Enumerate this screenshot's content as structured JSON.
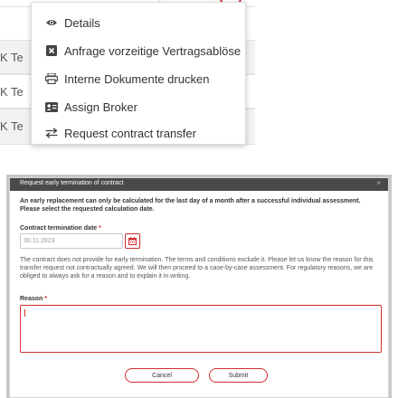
{
  "table": {
    "row_truncated_label": "K Te"
  },
  "context_menu": {
    "items": [
      {
        "label": "Details",
        "icon": "eye-icon"
      },
      {
        "label": "Anfrage vorzeitige Vertragsablöse",
        "icon": "close-box-icon"
      },
      {
        "label": "Interne Dokumente drucken",
        "icon": "print-icon"
      },
      {
        "label": "Assign Broker",
        "icon": "id-card-icon"
      },
      {
        "label": "Request contract transfer",
        "icon": "transfer-arrows-icon"
      }
    ]
  },
  "dialog": {
    "title": "Request early termination of contract",
    "close_glyph": "×",
    "notice_line1": "An early replacement can only be calculated for the last day of a month after a successful individual assessment.",
    "notice_line2": "Please select the requested calculation date.",
    "date_label": "Contract termination date",
    "date_value": "30.11.2023",
    "required_marker": "*",
    "info_text": "The contract does not provide for early termination. The terms and conditions exclude it. Please let us know the reason for this transfer request not contractually agreed. We will then proceed to a case-by-case assessment. For regulatory reasons, we are obliged to always ask for a reason and to explain it in writing.",
    "reason_label": "Reason",
    "reason_value": "",
    "cancel_label": "Cancel",
    "submit_label": "Submit"
  },
  "colors": {
    "accent": "#d32f2f",
    "header_bg": "#4a4a4a"
  }
}
